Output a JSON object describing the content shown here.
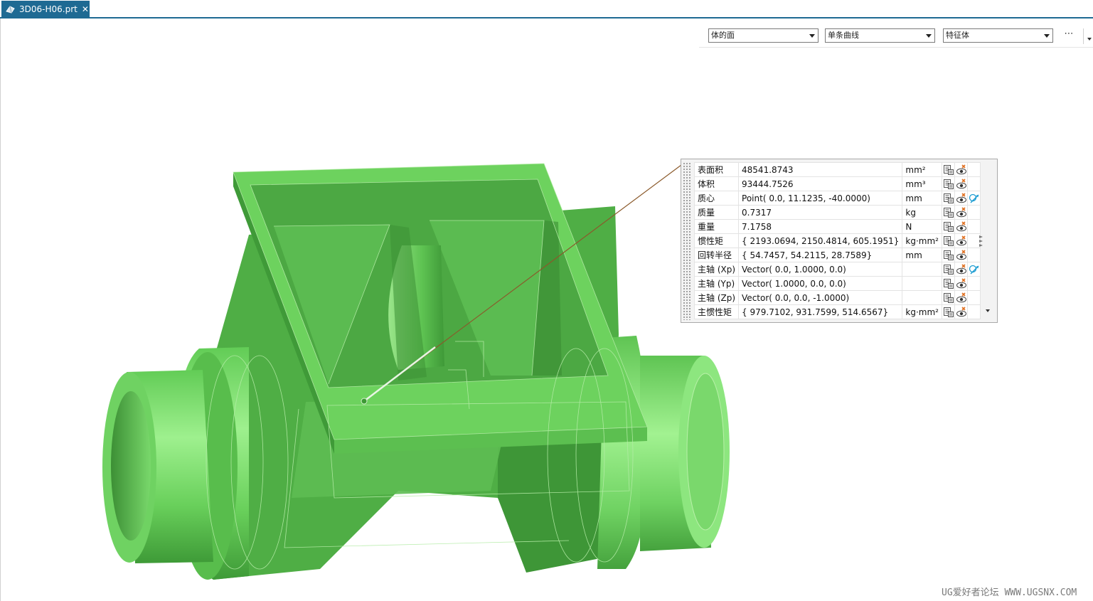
{
  "tab": {
    "title": "3D06-H06.prt",
    "close": "✕",
    "icon": "part-file-icon"
  },
  "filter_bar": {
    "face_filter": "体的面",
    "curve_rule": "单条曲线",
    "feature_filter": "特征体",
    "more": "⋯"
  },
  "measure": {
    "rows": [
      {
        "label": "表面积",
        "value": "48541.8743",
        "unit": "mm²",
        "has_vector": false
      },
      {
        "label": "体积",
        "value": "93444.7526",
        "unit": "mm³",
        "has_vector": false
      },
      {
        "label": "质心",
        "value": "Point( 0.0, 11.1235, -40.0000)",
        "unit": "mm",
        "has_vector": true
      },
      {
        "label": "质量",
        "value": "0.7317",
        "unit": "kg",
        "has_vector": false
      },
      {
        "label": "重量",
        "value": "7.1758",
        "unit": "N",
        "has_vector": false
      },
      {
        "label": "惯性矩",
        "value": "{ 2193.0694, 2150.4814, 605.1951}",
        "unit": "kg·mm²",
        "has_vector": false
      },
      {
        "label": "回转半径",
        "value": "{ 54.7457, 54.2115, 28.7589}",
        "unit": "mm",
        "has_vector": false
      },
      {
        "label": "主轴 (Xp)",
        "value": "Vector( 0.0, 1.0000, 0.0)",
        "unit": "",
        "has_vector": true
      },
      {
        "label": "主轴 (Yp)",
        "value": "Vector( 1.0000, 0.0, 0.0)",
        "unit": "",
        "has_vector": false
      },
      {
        "label": "主轴 (Zp)",
        "value": "Vector( 0.0, 0.0, -1.0000)",
        "unit": "",
        "has_vector": false
      },
      {
        "label": "主惯性矩",
        "value": "{ 979.7102, 931.7599, 514.6567}",
        "unit": "kg·mm²",
        "has_vector": false
      }
    ]
  },
  "colors": {
    "accent": "#1e6a93",
    "model_light": "#8de67f",
    "model_mid": "#6bd45b",
    "model_dark": "#3f9a3a",
    "leader": "#8b5a2b"
  },
  "watermark": "UG爱好者论坛 WWW.UGSNX.COM"
}
